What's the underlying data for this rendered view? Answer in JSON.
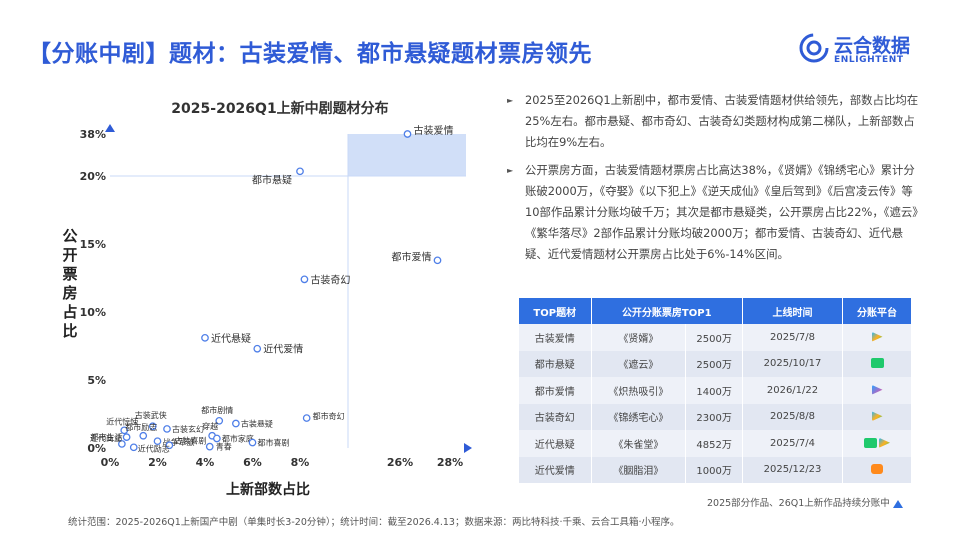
{
  "page": {
    "title": "【分账中剧】题材：古装爱情、都市悬疑题材票房领先",
    "logo": {
      "text": "云合数据",
      "sub": "ENLIGHTENT"
    },
    "chart_title": "2025-2026Q1上新中剧题材分布",
    "bullets": [
      "2025至2026Q1上新剧中，都市爱情、古装爱情题材供给领先，部数占比均在25%左右。都市悬疑、都市奇幻、古装奇幻类题材构成第二梯队，上新部数占比均在9%左右。",
      "公开票房方面，古装爱情题材票房占比高达38%，《贤婿》《锦绣宅心》累计分账破2000万，《夺娶》《以下犯上》《逆天成仙》《皇后驾到》《后宫凌云传》等10部作品累计分账均破千万；其次是都市悬疑类，公开票房占比22%，《遮云》《繁华落尽》2部作品累计分账均破2000万；都市爱情、古装奇幻、近代悬疑、近代爱情题材公开票房占比处于6%-14%区间。"
    ],
    "table": {
      "headers": [
        "TOP题材",
        "公开分账票房TOP1",
        "上线时间",
        "分账平台"
      ],
      "rows": [
        {
          "genre": "古装爱情",
          "title": "《贤婿》",
          "box": "2500万",
          "date": "2025/7/8",
          "platforms": [
            "tencent"
          ]
        },
        {
          "genre": "都市悬疑",
          "title": "《遮云》",
          "box": "2500万",
          "date": "2025/10/17",
          "platforms": [
            "iqiyi"
          ]
        },
        {
          "genre": "都市爱情",
          "title": "《炽热吸引》",
          "box": "1400万",
          "date": "2026/1/22",
          "platforms": [
            "youku"
          ]
        },
        {
          "genre": "古装奇幻",
          "title": "《锦绣宅心》",
          "box": "2300万",
          "date": "2025/8/8",
          "platforms": [
            "tencent"
          ]
        },
        {
          "genre": "近代悬疑",
          "title": "《朱雀堂》",
          "box": "4852万",
          "date": "2025/7/4",
          "platforms": [
            "iqiyi",
            "tencent"
          ]
        },
        {
          "genre": "近代爱情",
          "title": "《胭脂泪》",
          "box": "1000万",
          "date": "2025/12/23",
          "platforms": [
            "mango"
          ]
        }
      ]
    },
    "footnote": "2025部分作品、26Q1上新作品持续分账中",
    "source": "统计范围：2025-2026Q1上新国产中剧（单集时长3-20分钟）；统计时间：截至2026.4.13；数据来源：两比特科技·千乘、云合工具箱·小程序。"
  },
  "chart_data": {
    "type": "scatter",
    "title": "2025-2026Q1上新中剧题材分布",
    "xlabel": "上新部数占比",
    "ylabel": "公开票房占比",
    "x_ticks": [
      "0%",
      "2%",
      "4%",
      "6%",
      "8%",
      "26%",
      "28%"
    ],
    "y_ticks": [
      "0%",
      "5%",
      "10%",
      "15%",
      "20%",
      "38%"
    ],
    "axis_breaks": true,
    "highlight_region": {
      "y_from": 20,
      "y_to": 38
    },
    "points": [
      {
        "label": "古装爱情",
        "x": 26.3,
        "y": 38.0
      },
      {
        "label": "都市悬疑",
        "x": 8.0,
        "y": 22.0
      },
      {
        "label": "都市爱情",
        "x": 27.5,
        "y": 13.8
      },
      {
        "label": "古装奇幻",
        "x": 8.8,
        "y": 12.4
      },
      {
        "label": "近代悬疑",
        "x": 4.0,
        "y": 8.1
      },
      {
        "label": "近代爱情",
        "x": 6.2,
        "y": 7.3
      },
      {
        "label": "都市奇幻",
        "x": 9.2,
        "y": 2.2
      },
      {
        "label": "古装悬疑",
        "x": 5.3,
        "y": 1.8
      },
      {
        "label": "都市剧情",
        "x": 4.6,
        "y": 2.0
      },
      {
        "label": "古装武侠",
        "x": 1.8,
        "y": 1.6
      },
      {
        "label": "古装玄幻",
        "x": 2.4,
        "y": 1.4
      },
      {
        "label": "近代惊悚",
        "x": 0.6,
        "y": 1.3
      },
      {
        "label": "都市励志",
        "x": 1.4,
        "y": 0.9
      },
      {
        "label": "穿越",
        "x": 4.3,
        "y": 0.9
      },
      {
        "label": "都市生活",
        "x": 0.7,
        "y": 0.8
      },
      {
        "label": "都市家庭",
        "x": 4.5,
        "y": 0.7
      },
      {
        "label": "战争军旅",
        "x": 2.0,
        "y": 0.5
      },
      {
        "label": "都市喜剧",
        "x": 6.0,
        "y": 0.4
      },
      {
        "label": "近代商业",
        "x": 0.5,
        "y": 0.3
      },
      {
        "label": "古装喜剧",
        "x": 2.5,
        "y": 0.2
      },
      {
        "label": "青春",
        "x": 4.2,
        "y": 0.1
      },
      {
        "label": "近代励志",
        "x": 1.0,
        "y": 0.05
      }
    ]
  }
}
